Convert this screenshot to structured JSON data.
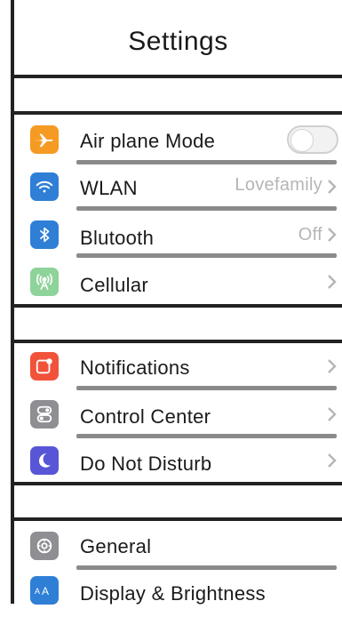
{
  "header": {
    "title": "Settings"
  },
  "groups": [
    {
      "items": [
        {
          "label": "Air plane Mode",
          "icon": "airplane-icon",
          "icon_color": "#F59A23",
          "control": "toggle",
          "toggle_on": false
        },
        {
          "label": "WLAN",
          "icon": "wifi-icon",
          "icon_color": "#2F7FD6",
          "value": "Lovefamily",
          "control": "chevron"
        },
        {
          "label": "Blutooth",
          "icon": "bluetooth-icon",
          "icon_color": "#2F7FD6",
          "value": "Off",
          "control": "chevron"
        },
        {
          "label": "Cellular",
          "icon": "cellular-antenna-icon",
          "icon_color": "#8ED39A",
          "control": "chevron"
        }
      ]
    },
    {
      "items": [
        {
          "label": "Notifications",
          "icon": "notifications-icon",
          "icon_color": "#F0533A",
          "control": "chevron"
        },
        {
          "label": "Control Center",
          "icon": "control-center-icon",
          "icon_color": "#8E8E93",
          "control": "chevron"
        },
        {
          "label": "Do Not Disturb",
          "icon": "moon-icon",
          "icon_color": "#5856D6",
          "control": "chevron"
        }
      ]
    },
    {
      "items": [
        {
          "label": "General",
          "icon": "gear-icon",
          "icon_color": "#8E8E93",
          "control": "none"
        },
        {
          "label": "Display & Brightness",
          "icon": "display-brightness-icon",
          "icon_color": "#2F7FD6",
          "control": "none"
        }
      ]
    }
  ],
  "colors": {
    "value_text": "#B5B5B5",
    "separator": "#8A8A8A",
    "frame": "#222222"
  }
}
